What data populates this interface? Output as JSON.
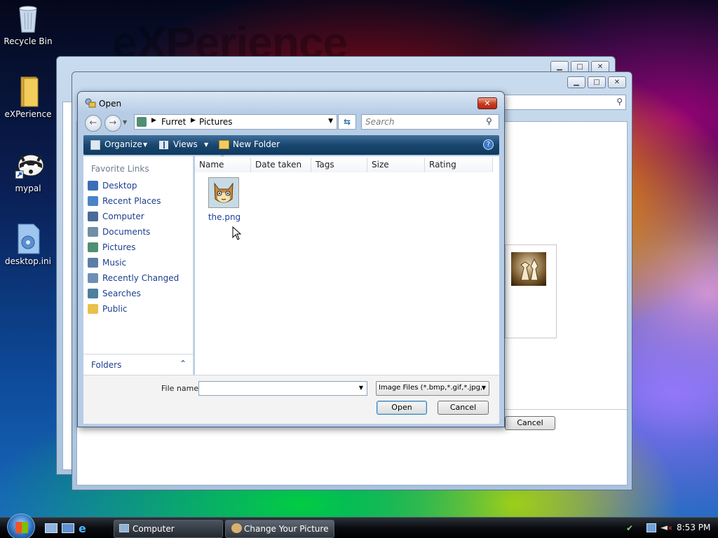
{
  "desktop": {
    "watermark": "eXPerience",
    "icons": [
      {
        "label": "Recycle Bin"
      },
      {
        "label": "eXPerience"
      },
      {
        "label": "mypal"
      },
      {
        "label": "desktop.ini"
      }
    ]
  },
  "dialog": {
    "title": "Open",
    "breadcrumb": [
      "Furret",
      "Pictures"
    ],
    "search_placeholder": "Search",
    "toolbar": {
      "organize": "Organize",
      "views": "Views",
      "new_folder": "New Folder"
    },
    "favorite_links_header": "Favorite Links",
    "favorite_links": [
      {
        "label": "Desktop",
        "icon": "desktop-icon",
        "color": "#3a6fb7"
      },
      {
        "label": "Recent Places",
        "icon": "recent-places-icon",
        "color": "#4a84c8"
      },
      {
        "label": "Computer",
        "icon": "computer-icon",
        "color": "#4a6a9a"
      },
      {
        "label": "Documents",
        "icon": "documents-icon",
        "color": "#6f8fa6"
      },
      {
        "label": "Pictures",
        "icon": "pictures-icon",
        "color": "#4f8f73"
      },
      {
        "label": "Music",
        "icon": "music-icon",
        "color": "#5a7fa7"
      },
      {
        "label": "Recently Changed",
        "icon": "recently-changed-icon",
        "color": "#6d8fb7"
      },
      {
        "label": "Searches",
        "icon": "searches-icon",
        "color": "#4d7f9f"
      },
      {
        "label": "Public",
        "icon": "public-folder-icon",
        "color": "#e8c04a"
      }
    ],
    "folders_label": "Folders",
    "columns": [
      "Name",
      "Date taken",
      "Tags",
      "Size",
      "Rating"
    ],
    "files": [
      {
        "name": "the.png"
      }
    ],
    "file_name_label": "File name:",
    "file_name_value": "",
    "file_type": "Image Files (*.bmp,*.gif,*.jpg,*",
    "open_button": "Open",
    "cancel_button": "Cancel"
  },
  "background_window": {
    "cancel_button": "Cancel"
  },
  "taskbar": {
    "tasks": [
      "Computer",
      "Change Your Picture"
    ],
    "clock": "8:53 PM"
  }
}
